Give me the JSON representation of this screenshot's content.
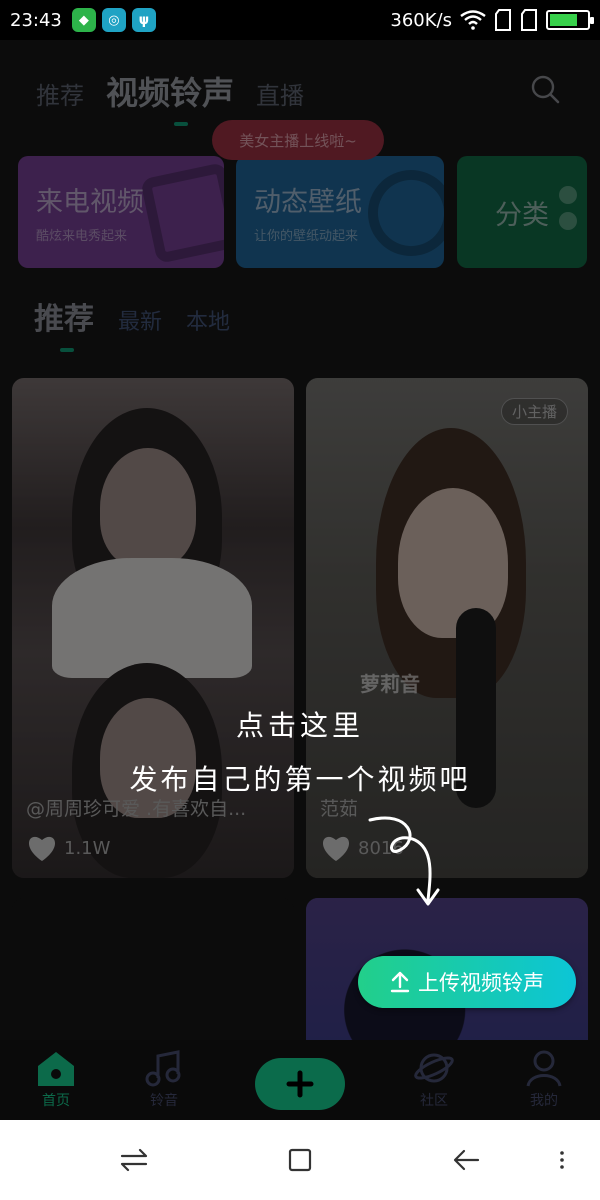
{
  "status_bar": {
    "time": "23:43",
    "speed": "360K/s",
    "battery_level": 0.75,
    "app_icons": [
      "wechat-like-icon",
      "browser-icon",
      "usb-icon"
    ]
  },
  "top_tabs": [
    {
      "label": "推荐",
      "active": false
    },
    {
      "label": "视频铃声",
      "active": true
    },
    {
      "label": "直播",
      "active": false
    }
  ],
  "live_bubble": "美女主播上线啦~",
  "categories": [
    {
      "title": "来电视频",
      "subtitle": "酷炫来电秀起来",
      "color": "#6a3a86"
    },
    {
      "title": "动态壁纸",
      "subtitle": "让你的壁纸动起来",
      "color": "#1d5b88"
    },
    {
      "title": "分类",
      "subtitle": "",
      "color": "#10603f"
    }
  ],
  "sub_tabs": [
    {
      "label": "推荐",
      "active": true
    },
    {
      "label": "最新",
      "active": false
    },
    {
      "label": "本地",
      "active": false
    }
  ],
  "cards": [
    {
      "caption": "@周周珍可爱 .有喜欢自...",
      "likes": "1.1W"
    },
    {
      "caption": "范茹",
      "likes": "8016",
      "badge": "小主播",
      "watermark": "萝莉音"
    }
  ],
  "guide": {
    "line1": "点击这里",
    "line2": "发布自己的第一个视频吧"
  },
  "upload_button": "上传视频铃声",
  "bottom_nav": {
    "home": "首页",
    "ringtone": "铃音",
    "community": "社区",
    "me": "我的"
  },
  "colors": {
    "accent": "#22cf8a",
    "accent2": "#0cc5d6"
  }
}
